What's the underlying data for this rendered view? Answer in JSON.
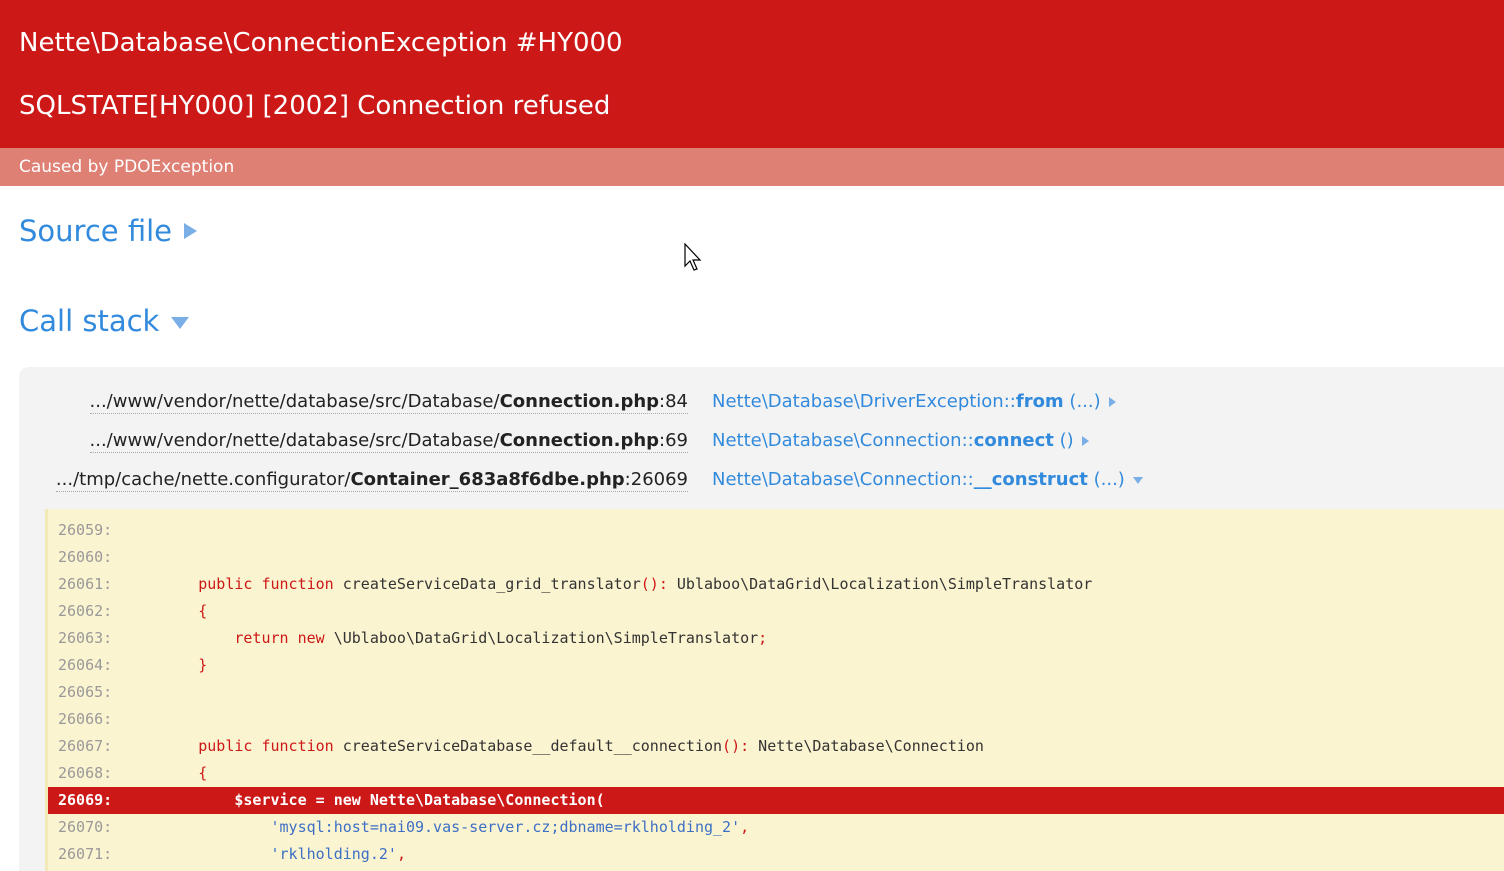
{
  "header": {
    "exception_title": "Nette\\Database\\ConnectionException #HY000",
    "message": "SQLSTATE[HY000] [2002] Connection refused",
    "caused_by": "Caused by PDOException"
  },
  "sections": {
    "source_file": "Source file",
    "call_stack": "Call stack"
  },
  "frames": [
    {
      "path": ".../www/vendor/nette/database/src/Database/",
      "file": "Connection.php",
      "line": ":84",
      "class": "Nette\\Database\\DriverException::",
      "method": "from",
      "args": " (...)",
      "expanded": false
    },
    {
      "path": ".../www/vendor/nette/database/src/Database/",
      "file": "Connection.php",
      "line": ":69",
      "class": "Nette\\Database\\Connection::",
      "method": "connect",
      "args": " ()",
      "expanded": false
    },
    {
      "path": ".../tmp/cache/nette.configurator/",
      "file": "Container_683a8f6dbe.php",
      "line": ":26069",
      "class": "Nette\\Database\\Connection::",
      "method": "__construct",
      "args": " (...)",
      "expanded": true
    }
  ],
  "code": {
    "lines": [
      {
        "num": "26059:",
        "text": ""
      },
      {
        "num": "26060:",
        "text": ""
      },
      {
        "num": "26061:",
        "kw": "public function",
        "text": " createServiceData_grid_translator",
        "punc": "():",
        "tail": " Ublaboo\\DataGrid\\Localization\\SimpleTranslator"
      },
      {
        "num": "26062:",
        "punc": "{"
      },
      {
        "num": "26063:",
        "kw": "return new",
        "text": " \\Ublaboo\\DataGrid\\Localization\\SimpleTranslator",
        "punc": ";"
      },
      {
        "num": "26064:",
        "punc": "}"
      },
      {
        "num": "26065:",
        "text": ""
      },
      {
        "num": "26066:",
        "text": ""
      },
      {
        "num": "26067:",
        "kw": "public function",
        "text": " createServiceDatabase__default__connection",
        "punc": "():",
        "tail": " Nette\\Database\\Connection"
      },
      {
        "num": "26068:",
        "punc": "{"
      },
      {
        "num": "26069:",
        "text": "$service = new Nette\\Database\\Connection(",
        "highlight": true
      },
      {
        "num": "26070:",
        "str": "'mysql:host=nai09.vas-server.cz;dbname=rklholding_2'",
        "punc": ","
      },
      {
        "num": "26071:",
        "str": "'rklholding.2'",
        "punc": ","
      }
    ]
  },
  "colors": {
    "header_red": "#cd1818",
    "caused_bg": "#df8075",
    "link_blue": "#328adc",
    "code_bg": "#fbf4d0"
  }
}
